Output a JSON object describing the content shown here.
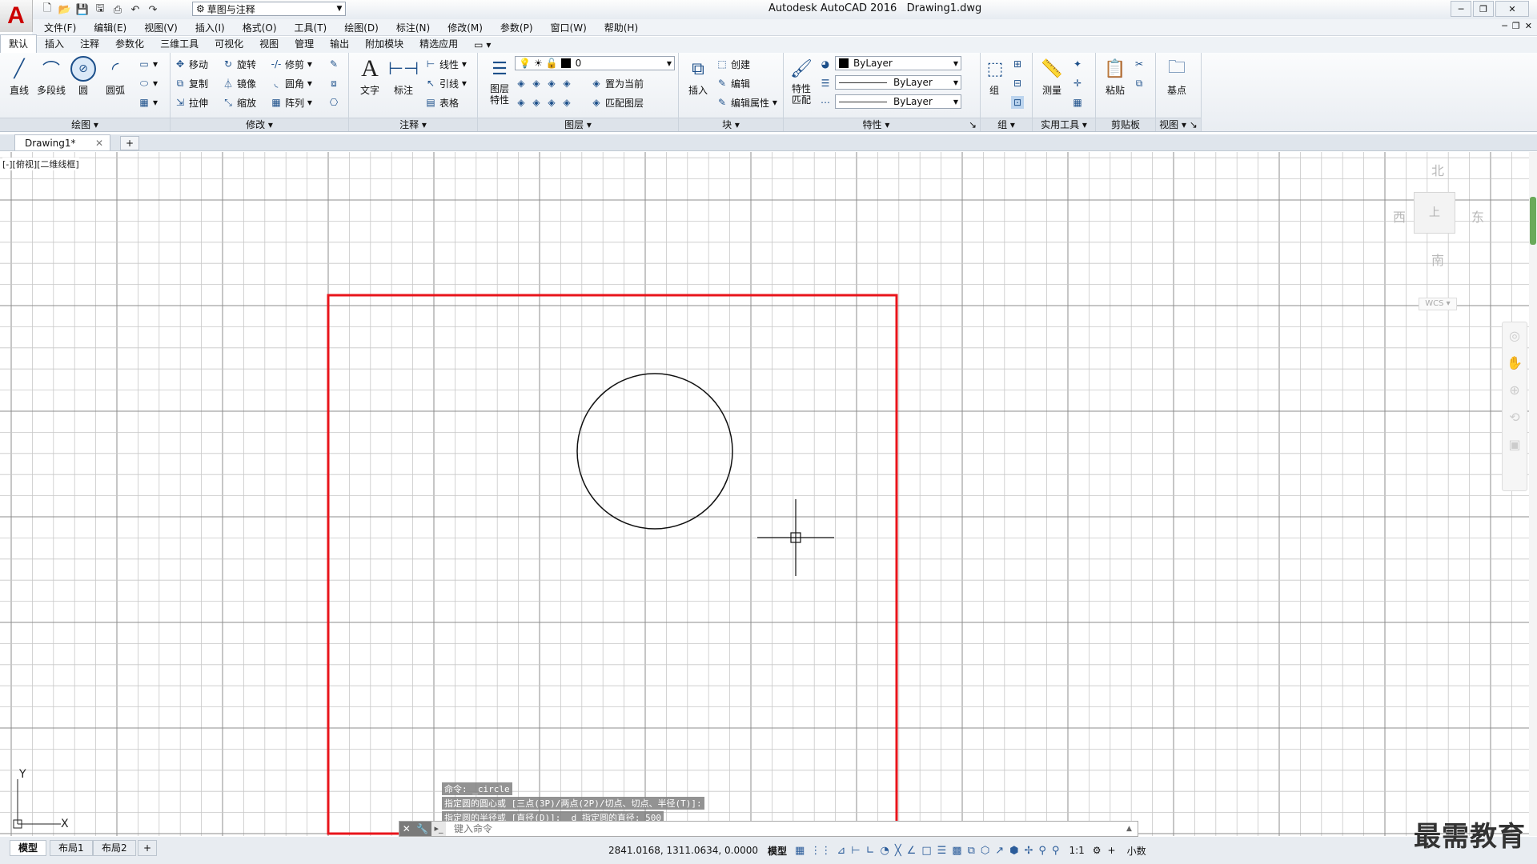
{
  "title": {
    "app": "Autodesk AutoCAD 2016",
    "file": "Drawing1.dwg",
    "workspace": "草图与注释"
  },
  "menu": [
    "文件(F)",
    "编辑(E)",
    "视图(V)",
    "插入(I)",
    "格式(O)",
    "工具(T)",
    "绘图(D)",
    "标注(N)",
    "修改(M)",
    "参数(P)",
    "窗口(W)",
    "帮助(H)"
  ],
  "ribbon_tabs": [
    "默认",
    "插入",
    "注释",
    "参数化",
    "三维工具",
    "可视化",
    "视图",
    "管理",
    "输出",
    "附加模块",
    "精选应用"
  ],
  "draw_panel": {
    "title": "绘图",
    "line": "直线",
    "polyline": "多段线",
    "circle": "圆",
    "arc": "圆弧"
  },
  "modify_panel": {
    "title": "修改",
    "move": "移动",
    "rotate": "旋转",
    "trim": "修剪",
    "copy": "复制",
    "mirror": "镜像",
    "fillet": "圆角",
    "stretch": "拉伸",
    "scale": "缩放",
    "array": "阵列"
  },
  "annotation_panel": {
    "title": "注释",
    "text": "文字",
    "dimension": "标注",
    "linear": "线性",
    "leader": "引线",
    "table": "表格"
  },
  "layers_panel": {
    "title": "图层",
    "layer_props": "图层特性",
    "current_layer": "0",
    "set_current": "置为当前",
    "match_layer": "匹配图层"
  },
  "block_panel": {
    "title": "块",
    "insert": "插入",
    "create": "创建",
    "edit": "编辑",
    "edit_attrs": "编辑属性"
  },
  "properties_panel": {
    "title": "特性",
    "match": "特性匹配",
    "color": "ByLayer",
    "linetype": "ByLayer",
    "lineweight": "ByLayer"
  },
  "group_panel": {
    "title": "组",
    "group": "组"
  },
  "utilities_panel": {
    "title": "实用工具",
    "measure": "测量"
  },
  "clipboard_panel": {
    "title": "剪贴板",
    "paste": "粘贴"
  },
  "view_panel": {
    "title": "视图",
    "base": "基点"
  },
  "file_tab": "Drawing1*",
  "viewport_label": "[-][俯视][二维线框]",
  "viewcube": {
    "n": "北",
    "s": "南",
    "w": "西",
    "e": "东",
    "top": "上",
    "wcs": "WCS"
  },
  "ucs": {
    "x": "X",
    "y": "Y"
  },
  "command_history": [
    "命令: _circle",
    "指定圆的圆心或 [三点(3P)/两点(2P)/切点、切点、半径(T)]:",
    "指定圆的半径或 [直径(D)]: _d 指定圆的直径: 500"
  ],
  "command_placeholder": "键入命令",
  "layout_tabs": [
    "模型",
    "布局1",
    "布局2"
  ],
  "status": {
    "coords": "2841.0168, 1311.0634, 0.0000",
    "space": "模型",
    "scale": "1:1",
    "units": "小数"
  },
  "watermark": "最需教育",
  "colors": {
    "boundary": "#e8141b",
    "grid_minor": "#c8c8c8",
    "grid_major": "#8c8c8c",
    "accent": "#2b5c9a"
  }
}
